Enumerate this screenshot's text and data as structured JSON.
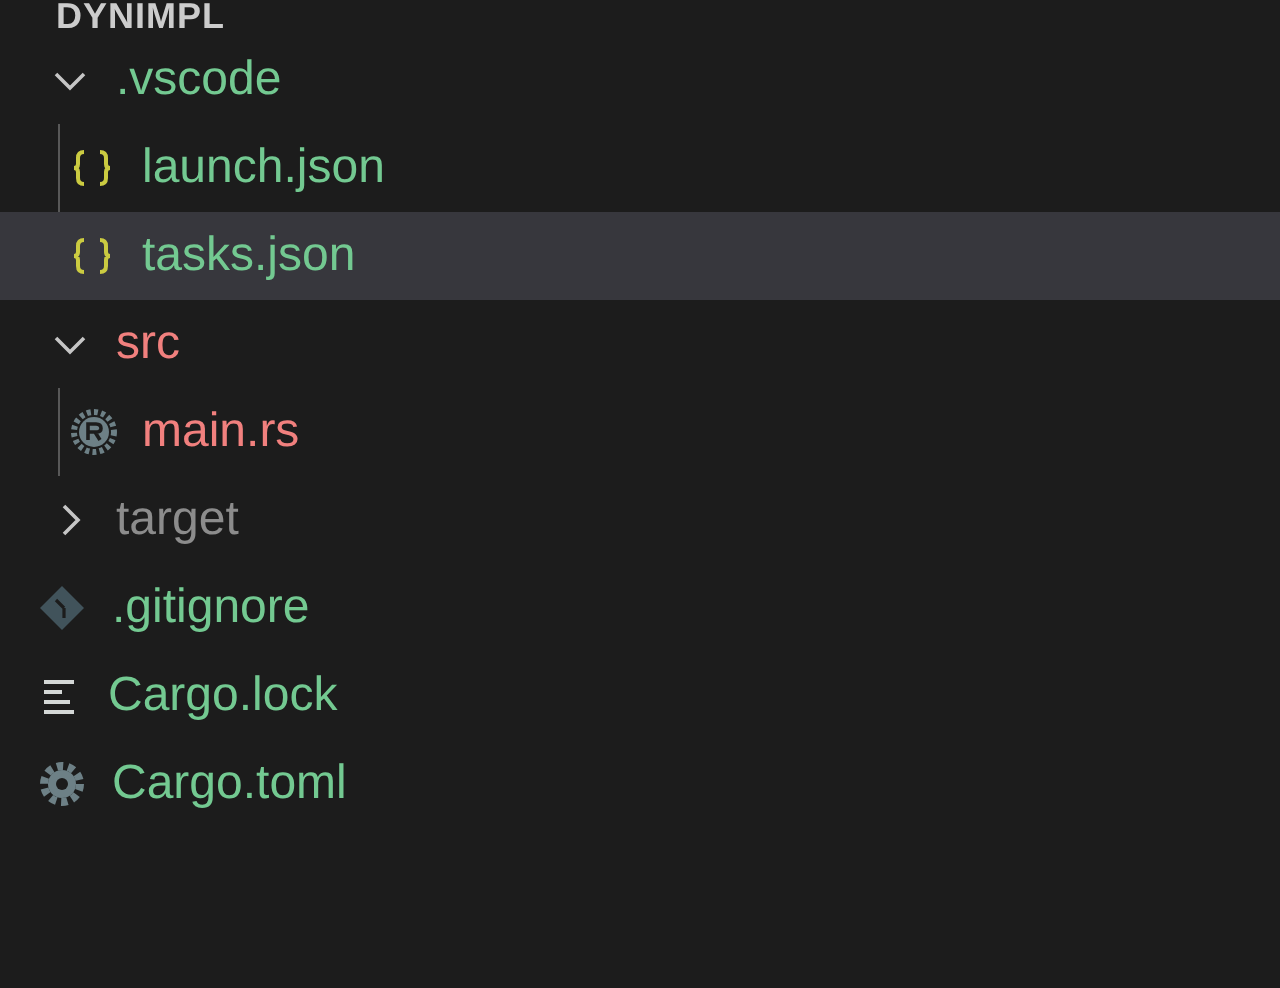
{
  "explorer": {
    "title": "DYNIMPL",
    "tree": [
      {
        "name": ".vscode",
        "kind": "folder",
        "expanded": true,
        "selected": false,
        "color": "#73c991",
        "children": [
          {
            "name": "launch.json",
            "kind": "json",
            "selected": false,
            "color": "#73c991"
          },
          {
            "name": "tasks.json",
            "kind": "json",
            "selected": true,
            "color": "#73c991"
          }
        ]
      },
      {
        "name": "src",
        "kind": "folder",
        "expanded": true,
        "selected": false,
        "color": "#f1807e",
        "children": [
          {
            "name": "main.rs",
            "kind": "rust",
            "selected": false,
            "color": "#f1807e"
          }
        ]
      },
      {
        "name": "target",
        "kind": "folder",
        "expanded": false,
        "selected": false,
        "color": "#8c8c8c"
      },
      {
        "name": ".gitignore",
        "kind": "git",
        "selected": false,
        "color": "#73c991"
      },
      {
        "name": "Cargo.lock",
        "kind": "lines",
        "selected": false,
        "color": "#73c991"
      },
      {
        "name": "Cargo.toml",
        "kind": "gear",
        "selected": false,
        "color": "#73c991"
      }
    ]
  }
}
